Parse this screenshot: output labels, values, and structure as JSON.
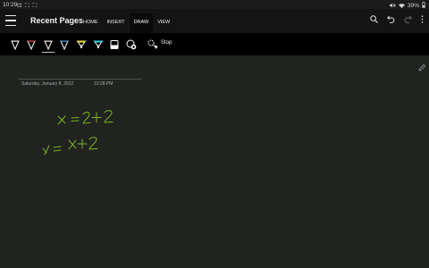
{
  "status": {
    "time": "10:29",
    "sys_icons": "⊡ ⛶ ⛶",
    "battery": "39%"
  },
  "app": {
    "title": "Recent Pages"
  },
  "tabs": [
    {
      "label": "HOME"
    },
    {
      "label": "INSERT"
    },
    {
      "label": "DRAW"
    },
    {
      "label": "VIEW"
    }
  ],
  "toolbar": {
    "stop_label": "Stop",
    "pens": [
      {
        "name": "pen-white",
        "color": "#f2f2f2"
      },
      {
        "name": "pen-red",
        "color": "#e84b5a"
      },
      {
        "name": "pen-white-selected",
        "color": "#f2f2f2"
      },
      {
        "name": "pen-blue",
        "color": "#4aa3ff"
      },
      {
        "name": "highlighter-yellow",
        "color": "#f5e23a"
      },
      {
        "name": "highlighter-cyan",
        "color": "#38d0ee"
      }
    ]
  },
  "page": {
    "date": "Saturday, January 8, 2022",
    "time": "10:28 PM",
    "ink_color": "#7fb51c"
  }
}
